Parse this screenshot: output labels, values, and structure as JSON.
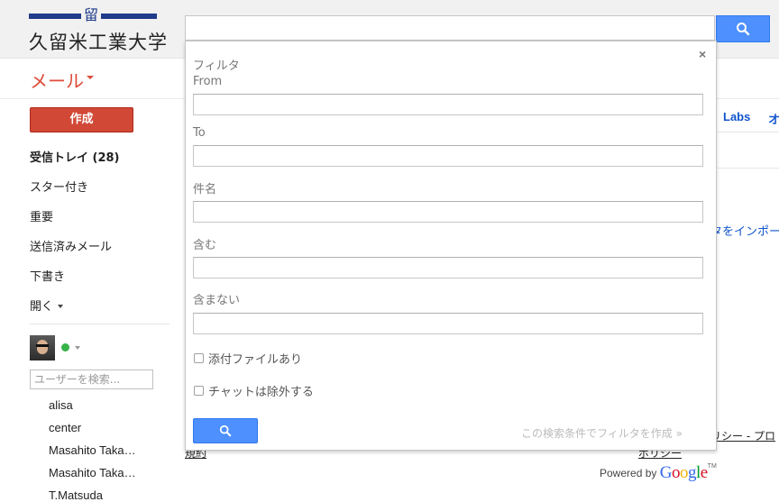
{
  "header": {
    "logo_emblem": "留",
    "logo_text": "久留米工業大学",
    "search_value": ""
  },
  "secondary": {
    "mail_label": "メール"
  },
  "sidebar": {
    "compose_label": "作成",
    "items": [
      {
        "label": "受信トレイ (28)"
      },
      {
        "label": "スター付き"
      },
      {
        "label": "重要"
      },
      {
        "label": "送信済みメール"
      },
      {
        "label": "下書き"
      },
      {
        "label": "開く"
      }
    ],
    "user_search_placeholder": "ユーザーを検索...",
    "contacts": [
      "alisa",
      "center",
      "Masahito Taka…",
      "Masahito Taka…",
      "T.Matsuda"
    ]
  },
  "background": {
    "labs_link": "Labs",
    "other_link": "オ",
    "import_text": "タをインポー",
    "policy_right": "リシー - プロ",
    "terms": "規約",
    "policy": "ポリシー",
    "powered_by": "Powered by",
    "google_logo": [
      "G",
      "o",
      "o",
      "g",
      "l",
      "e"
    ],
    "google_tm": "TM"
  },
  "filter": {
    "title": "フィルタ",
    "close": "×",
    "fields": [
      {
        "label": "From",
        "value": ""
      },
      {
        "label": "To",
        "value": ""
      },
      {
        "label": "件名",
        "value": ""
      },
      {
        "label": "含む",
        "value": ""
      },
      {
        "label": "含まない",
        "value": ""
      }
    ],
    "checkboxes": [
      {
        "label": "添付ファイルあり",
        "checked": false
      },
      {
        "label": "チャットは除外する",
        "checked": false
      }
    ],
    "create_filter_link": "この検索条件でフィルタを作成 »"
  },
  "colors": {
    "accent_blue": "#4d90fe",
    "compose_red": "#d14836",
    "mail_red": "#dd4b39",
    "logo_navy": "#1f3b8a",
    "online_green": "#37b34a"
  },
  "icons": {
    "search": "search-icon",
    "close": "close-icon",
    "caret": "chevron-down-icon"
  }
}
